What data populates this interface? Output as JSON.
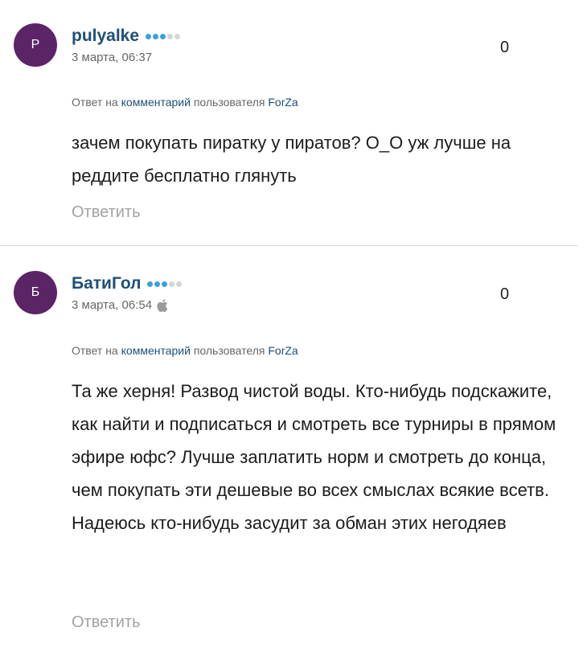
{
  "comments": [
    {
      "avatar_letter": "P",
      "author": "pulyalke",
      "rating": {
        "filled": 3,
        "total": 5
      },
      "timestamp": "3 марта, 06:37",
      "device_icon": "",
      "score": "0",
      "reply_prefix": "Ответ на",
      "reply_link": "комментарий",
      "reply_middle": "пользователя",
      "reply_user": "ForZa",
      "text": "зачем покупать пиратку у пиратов? О_О уж лучше на реддите бесплатно глянуть",
      "answer_label": "Ответить"
    },
    {
      "avatar_letter": "Б",
      "author": "БатиГол",
      "rating": {
        "filled": 3,
        "total": 5
      },
      "timestamp": "3 марта, 06:54",
      "device_icon": "apple-icon",
      "score": "0",
      "reply_prefix": "Ответ на",
      "reply_link": "комментарий",
      "reply_middle": "пользователя",
      "reply_user": "ForZa",
      "text": "Та же херня! Развод чистой воды. Кто-нибудь подскажите, как найти и подписаться и смотреть все турниры в прямом эфире юфс? Лучше заплатить норм и смотреть до конца, чем покупать эти дешевые во всех смыслах всякие всетв. Надеюсь кто-нибудь засудит за обман этих негодяев",
      "answer_label": "Ответить"
    }
  ],
  "colors": {
    "avatar_bg": "#5b2467",
    "author": "#1d4f79",
    "dot_filled": "#3aa1d8",
    "dot_empty": "#d6d6d6",
    "answer": "#a2a2a2"
  }
}
